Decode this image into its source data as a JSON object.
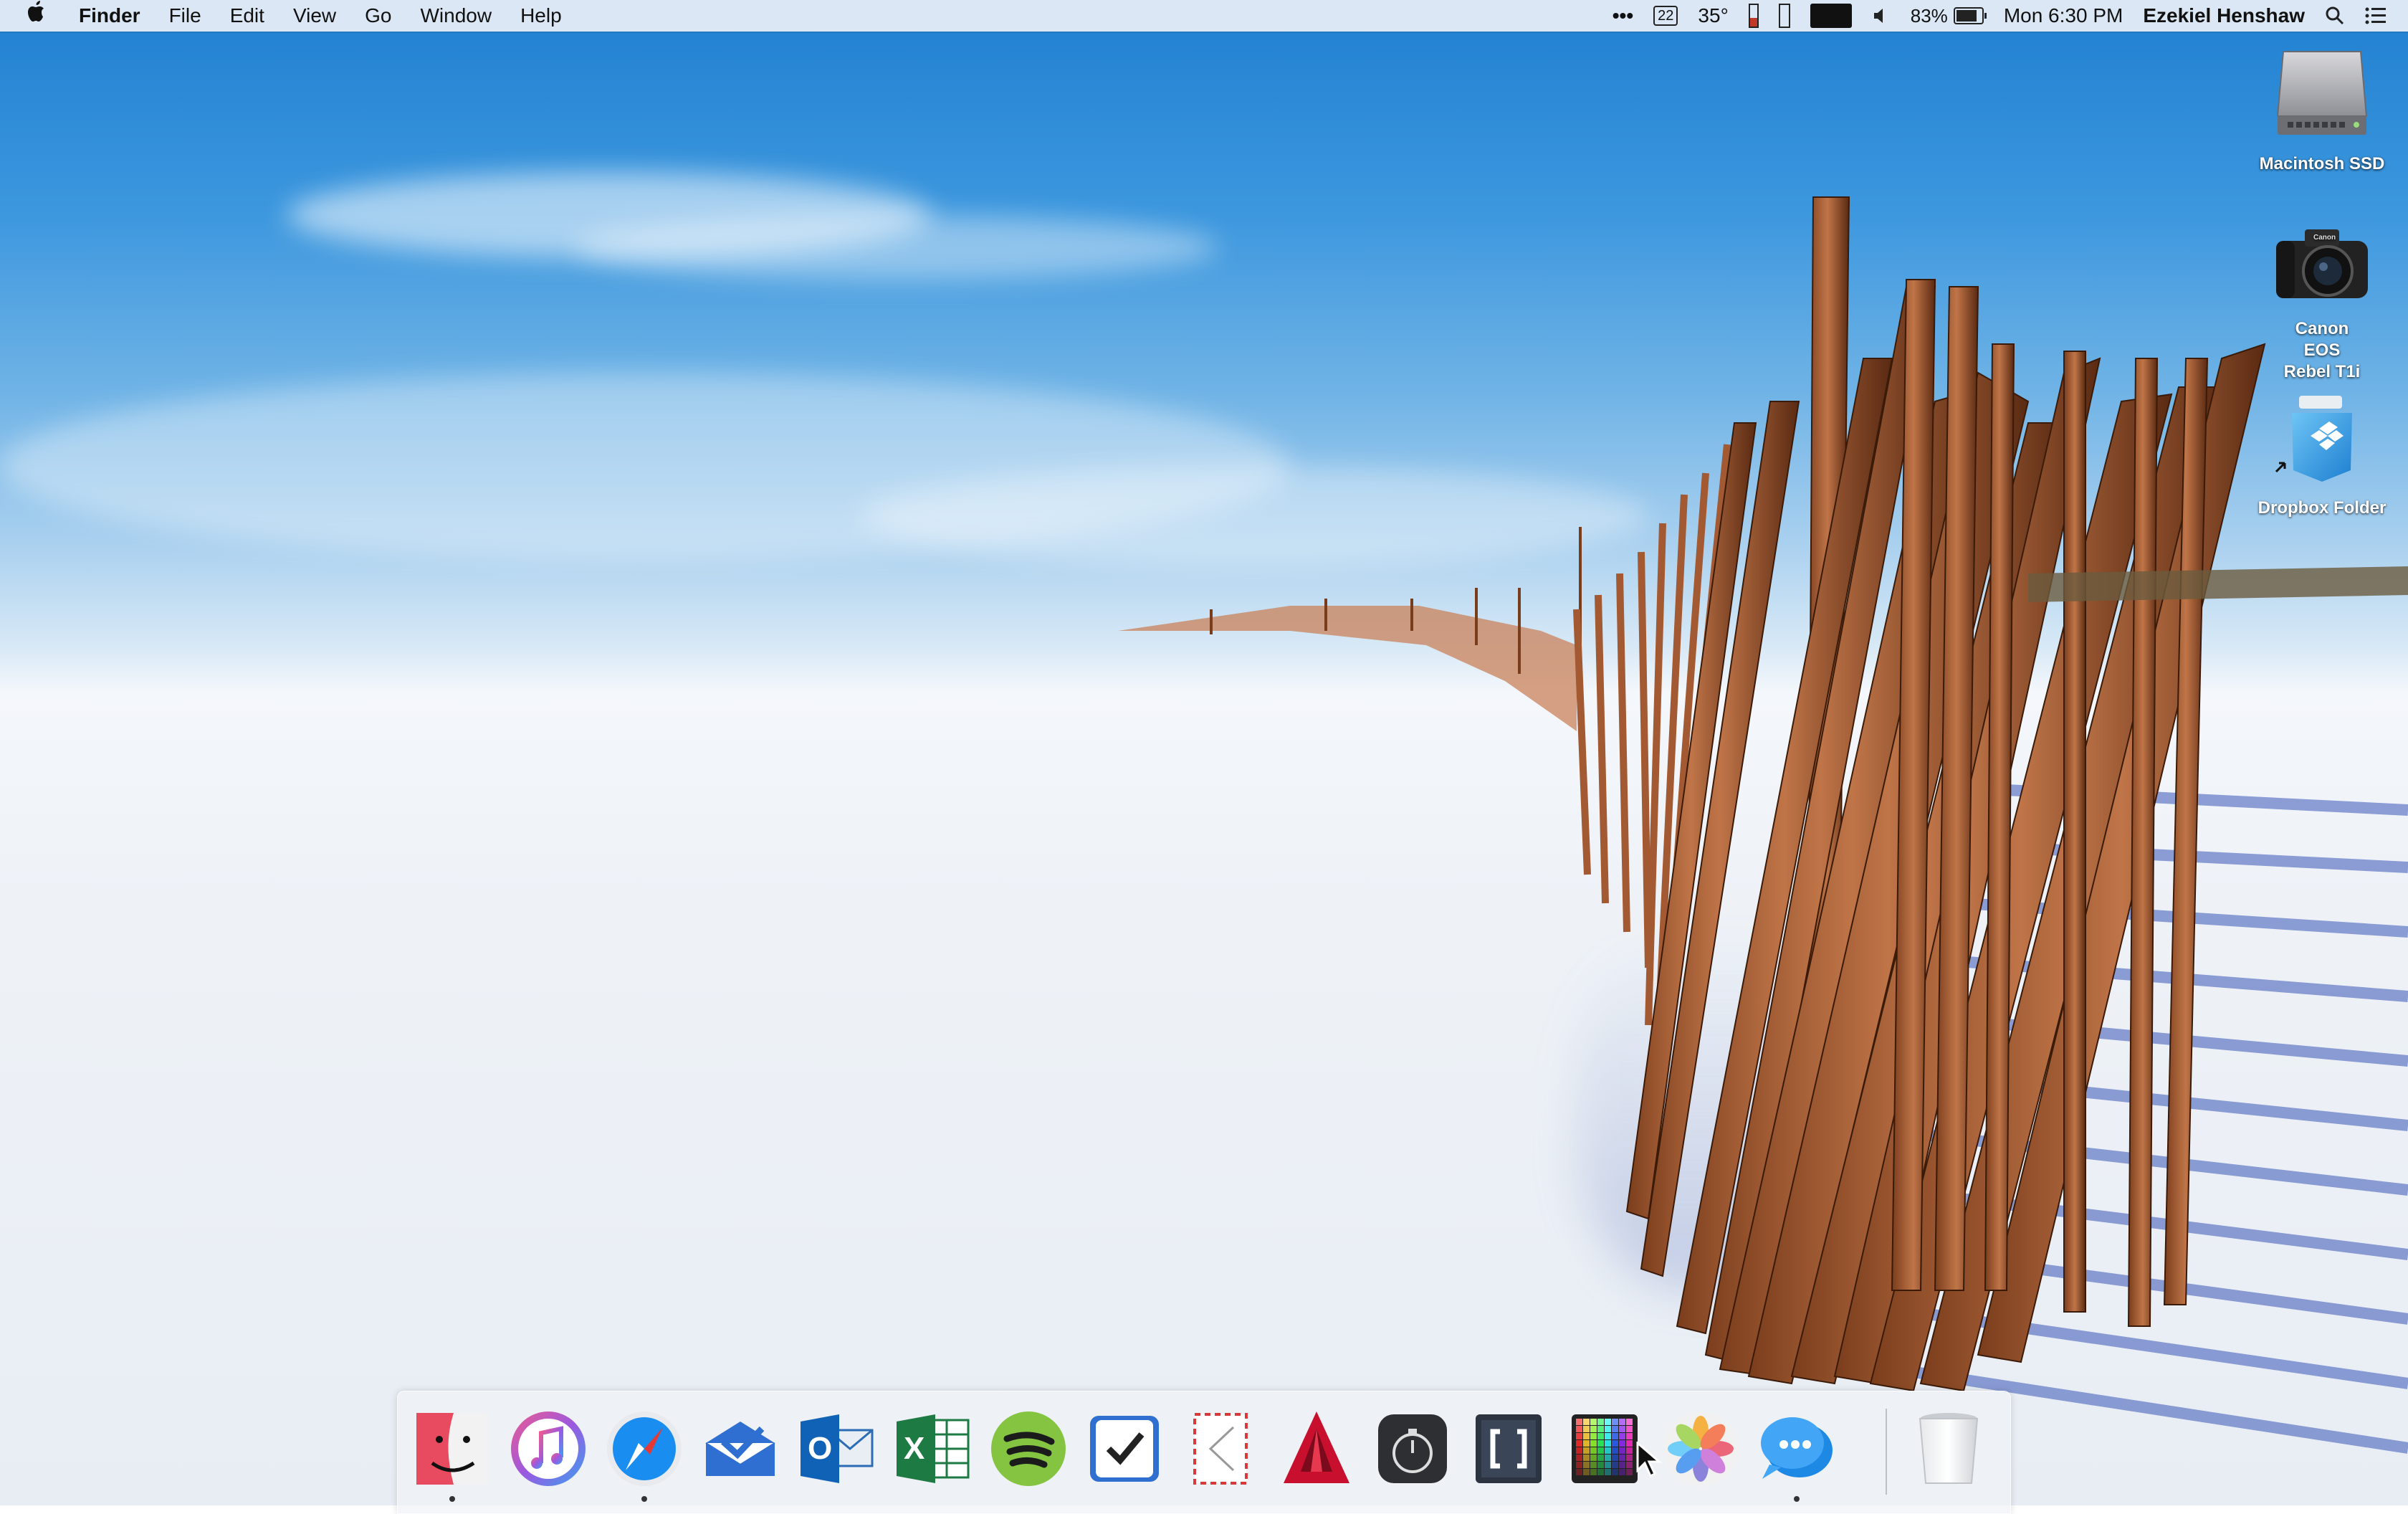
{
  "menubar": {
    "apple_icon": "apple-logo-icon",
    "app_name": "Finder",
    "menus": [
      "File",
      "Edit",
      "View",
      "Go",
      "Window",
      "Help"
    ],
    "status": {
      "more_glyph": "•••",
      "calendar_day": "22",
      "weather": "35°",
      "battery_percent": "83%",
      "battery_level": 0.83,
      "clock": "Mon 6:30 PM",
      "user": "Ezekiel Henshaw",
      "icons": [
        "more-icon",
        "calendar-icon",
        "weather-icon",
        "memory-icon",
        "cpu-icon",
        "activity-graph-icon",
        "volume-icon",
        "battery-icon",
        "spotlight-icon",
        "notification-center-icon"
      ]
    }
  },
  "desktop_icons": [
    {
      "name": "macintosh-ssd",
      "label": "Macintosh SSD",
      "icon": "hard-drive-icon"
    },
    {
      "name": "canon-camera",
      "label": "Canon EOS Rebel T1i",
      "icon": "camera-icon"
    },
    {
      "name": "dropbox-folder",
      "label": "Dropbox Folder",
      "icon": "dropbox-alias-icon"
    }
  ],
  "dock": {
    "apps": [
      {
        "id": "finder",
        "icon": "finder-icon",
        "running": true
      },
      {
        "id": "itunes",
        "icon": "itunes-icon",
        "running": false
      },
      {
        "id": "safari",
        "icon": "safari-icon",
        "running": true
      },
      {
        "id": "airmail",
        "icon": "mail-envelope-check-icon",
        "running": false
      },
      {
        "id": "outlook",
        "icon": "outlook-icon",
        "running": false
      },
      {
        "id": "excel",
        "icon": "excel-icon",
        "running": false
      },
      {
        "id": "spotify",
        "icon": "spotify-icon",
        "running": false
      },
      {
        "id": "things",
        "icon": "checkmark-tasks-icon",
        "running": false
      },
      {
        "id": "letter",
        "icon": "envelope-app-icon",
        "running": false
      },
      {
        "id": "autocad",
        "icon": "autocad-icon",
        "running": false
      },
      {
        "id": "timer",
        "icon": "stopwatch-icon",
        "running": false
      },
      {
        "id": "brackets",
        "icon": "brackets-icon",
        "running": false
      },
      {
        "id": "color-picker",
        "icon": "color-grid-icon",
        "running": false
      },
      {
        "id": "photos",
        "icon": "photos-icon",
        "running": false
      },
      {
        "id": "messages",
        "icon": "messages-icon",
        "running": true
      },
      {
        "id": "trash",
        "icon": "trash-icon",
        "running": false
      }
    ]
  }
}
